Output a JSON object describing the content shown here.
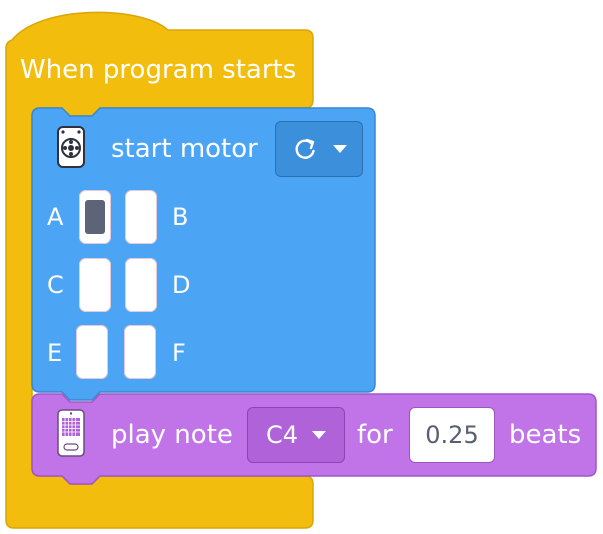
{
  "hat_block": {
    "label": "When program starts",
    "color": "#f2bd0c"
  },
  "motor_block": {
    "label": "start motor",
    "color": "#4ca4f4",
    "icon": "motor-icon",
    "direction_icon": "clockwise-icon",
    "ports": [
      {
        "letter": "A",
        "selected": true
      },
      {
        "letter": "B",
        "selected": false
      },
      {
        "letter": "C",
        "selected": false
      },
      {
        "letter": "D",
        "selected": false
      },
      {
        "letter": "E",
        "selected": false
      },
      {
        "letter": "F",
        "selected": false
      }
    ]
  },
  "note_block": {
    "label_prefix": "play note",
    "note": "C4",
    "label_mid": "for",
    "duration": "0.25",
    "label_suffix": "beats",
    "color": "#c074e8",
    "icon": "hub-icon"
  }
}
